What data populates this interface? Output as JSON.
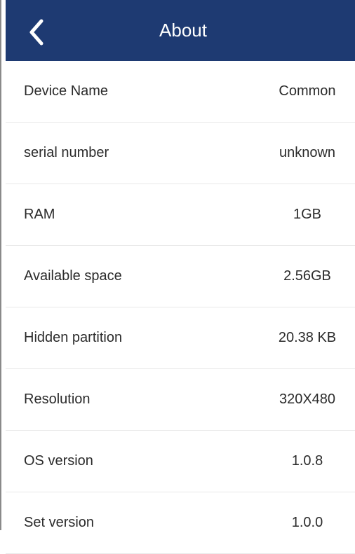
{
  "header": {
    "title": "About",
    "back_icon": "chevron-left-icon",
    "background": "#1e3a72"
  },
  "items": [
    {
      "label": "Device Name",
      "value": "Common"
    },
    {
      "label": "serial number",
      "value": "unknown"
    },
    {
      "label": "RAM",
      "value": "1GB"
    },
    {
      "label": "Available space",
      "value": "2.56GB"
    },
    {
      "label": "Hidden partition",
      "value": "20.38 KB"
    },
    {
      "label": "Resolution",
      "value": "320X480"
    },
    {
      "label": "OS version",
      "value": "1.0.8"
    },
    {
      "label": "Set version",
      "value": "1.0.0"
    }
  ]
}
